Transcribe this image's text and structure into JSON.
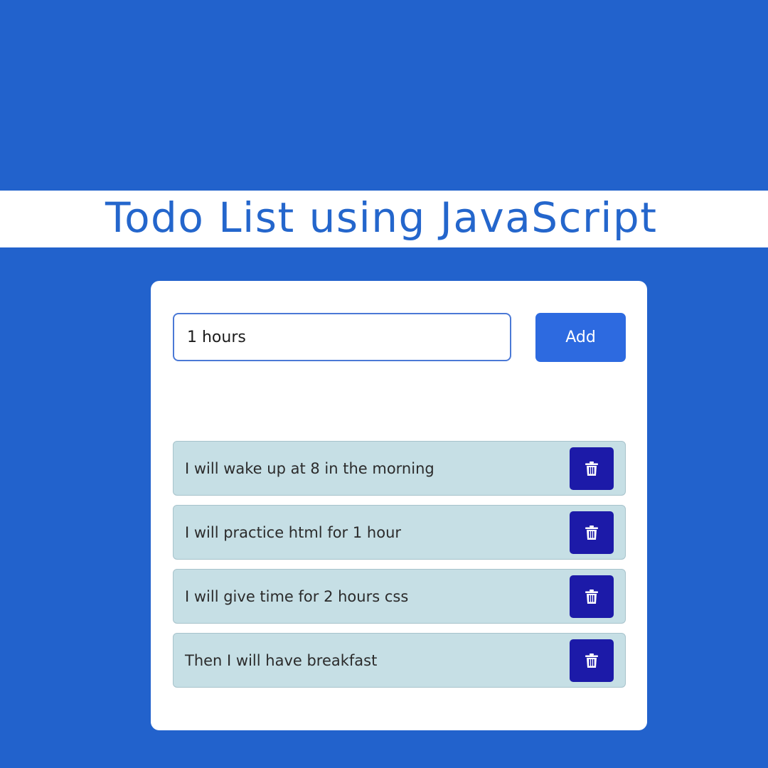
{
  "header": {
    "title": "Todo List using JavaScript"
  },
  "todo_form": {
    "input_value": "1 hours",
    "add_label": "Add"
  },
  "todos": [
    {
      "text": "I will wake up at 8 in the morning",
      "delete_icon": "trash-icon"
    },
    {
      "text": "I will practice html for 1 hour",
      "delete_icon": "trash-icon"
    },
    {
      "text": "I will give time for 2 hours css",
      "delete_icon": "trash-icon"
    },
    {
      "text": "Then I will have breakfast",
      "delete_icon": "trash-icon"
    }
  ],
  "colors": {
    "background": "#2262cc",
    "title_text": "#2466cc",
    "add_button": "#2d6ae0",
    "todo_item": "#c6dfe5",
    "delete_button": "#1c1aa8"
  }
}
